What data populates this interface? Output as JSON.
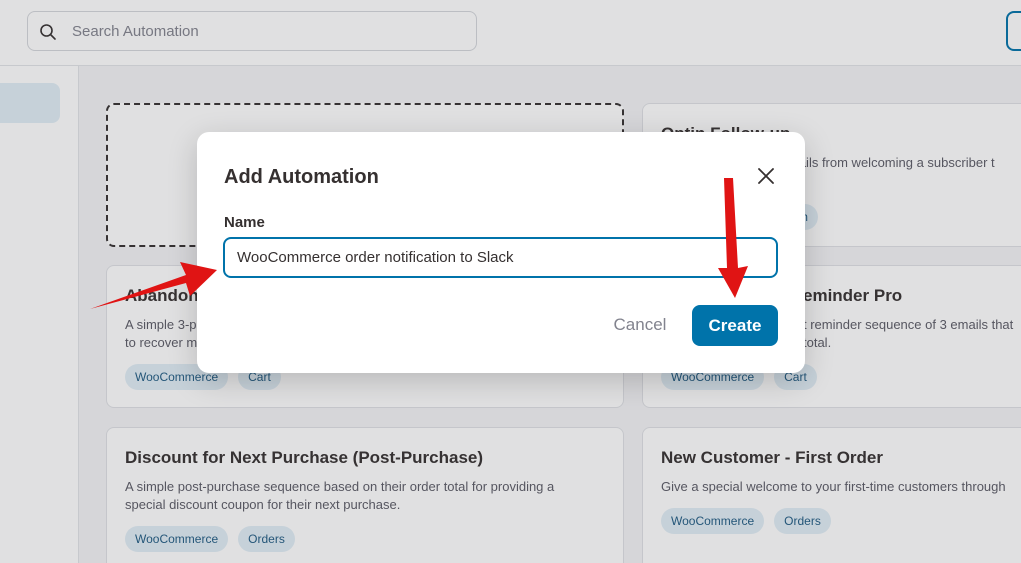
{
  "search": {
    "placeholder": "Search Automation",
    "icon": "search-icon"
  },
  "cards": [
    {
      "title": "Optin Follow-up",
      "description_lines": [
        "mails from welcoming a subscriber t"
      ],
      "tags": [
        "m"
      ]
    },
    {
      "title": "Abandone",
      "description_lines": [
        "A simple 3-p",
        "to recover m"
      ],
      "tags": [
        "WooCommerce",
        "Cart"
      ]
    },
    {
      "title": "eminder Pro",
      "description_lines": [
        "t reminder sequence of 3 emails that",
        "total."
      ],
      "tags": [
        "WooCommerce",
        "Cart"
      ]
    },
    {
      "title": "Discount for Next Purchase (Post-Purchase)",
      "description_lines": [
        "A simple post-purchase sequence based on their order total for providing a",
        "special discount coupon for their next purchase."
      ],
      "tags": [
        "WooCommerce",
        "Orders"
      ]
    },
    {
      "title": "New Customer - First Order",
      "description_lines": [
        "Give a special welcome to your first-time customers through"
      ],
      "tags": [
        "WooCommerce",
        "Orders"
      ]
    }
  ],
  "modal": {
    "title": "Add Automation",
    "name_label": "Name",
    "name_value": "WooCommerce order notification to Slack",
    "cancel_label": "Cancel",
    "create_label": "Create",
    "close_icon": "close-icon"
  },
  "colors": {
    "primary": "#0073aa",
    "tag_bg": "#e1eef6",
    "tag_text": "#1e5a82",
    "annotation_arrow": "#e01414"
  }
}
